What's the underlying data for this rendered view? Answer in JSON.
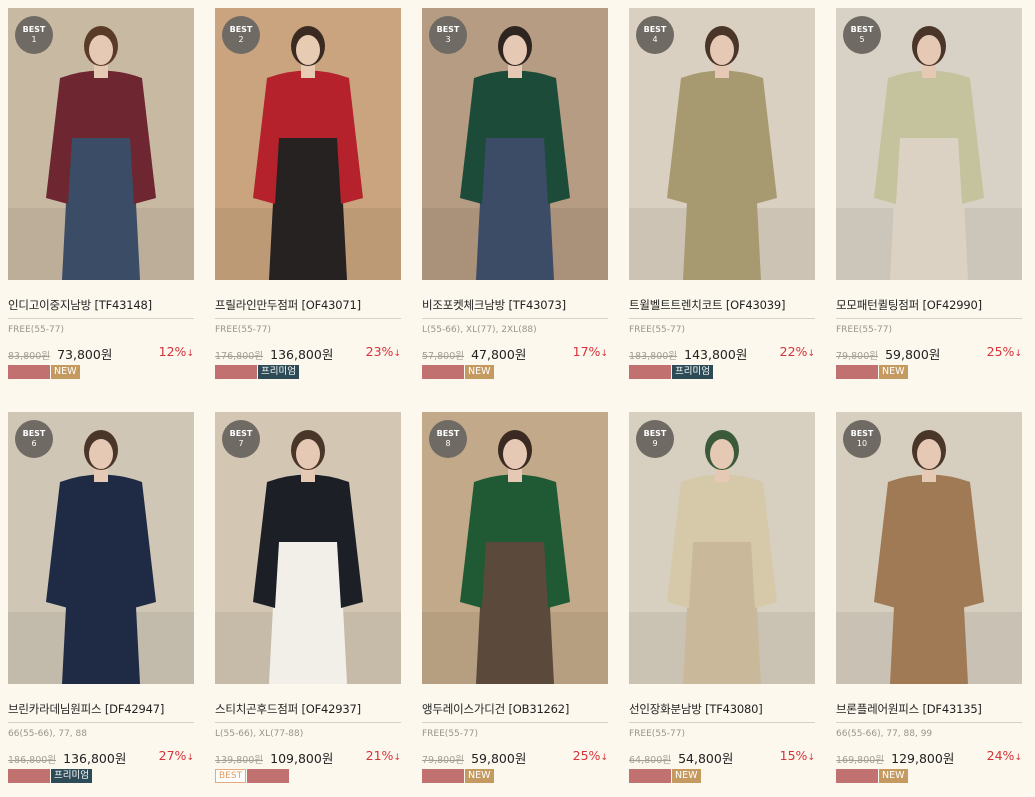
{
  "products": [
    {
      "badge_label": "BEST",
      "rank": "1",
      "title": "인디고이중지남방 [TF43148]",
      "sizes": "FREE(55-77)",
      "original_price": "83,800원",
      "sale_price": "73,800원",
      "discount": "12%",
      "discount_arrow": "↓",
      "tags": [
        {
          "type": "blank",
          "text": ""
        },
        {
          "type": "new",
          "text": "NEW"
        }
      ],
      "colors": {
        "bg": "#c8b9a2",
        "top": "#6e2630",
        "bottom": "#3a4c66",
        "skin": "#e6c9b5",
        "hair": "#5a3b28"
      }
    },
    {
      "badge_label": "BEST",
      "rank": "2",
      "title": "프릴라인만두점퍼 [OF43071]",
      "sizes": "FREE(55-77)",
      "original_price": "176,800원",
      "sale_price": "136,800원",
      "discount": "23%",
      "discount_arrow": "↓",
      "tags": [
        {
          "type": "blank",
          "text": ""
        },
        {
          "type": "premium",
          "text": "프리미엄"
        }
      ],
      "colors": {
        "bg": "#c9a47e",
        "top": "#b5222b",
        "bottom": "#262222",
        "skin": "#e8cbb3",
        "hair": "#3b2a22"
      }
    },
    {
      "badge_label": "BEST",
      "rank": "3",
      "title": "비조포켓체크남방 [TF43073]",
      "sizes": "L(55-66), XL(77), 2XL(88)",
      "original_price": "57,800원",
      "sale_price": "47,800원",
      "discount": "17%",
      "discount_arrow": "↓",
      "tags": [
        {
          "type": "blank",
          "text": ""
        },
        {
          "type": "new",
          "text": "NEW"
        }
      ],
      "colors": {
        "bg": "#b59c82",
        "top": "#1d4b39",
        "bottom": "#3c4c66",
        "skin": "#e6c9b5",
        "hair": "#2e2420"
      }
    },
    {
      "badge_label": "BEST",
      "rank": "4",
      "title": "트윌벨트트렌치코트 [OF43039]",
      "sizes": "FREE(55-77)",
      "original_price": "183,800원",
      "sale_price": "143,800원",
      "discount": "22%",
      "discount_arrow": "↓",
      "tags": [
        {
          "type": "blank",
          "text": ""
        },
        {
          "type": "premium",
          "text": "프리미엄"
        }
      ],
      "colors": {
        "bg": "#d9d0c1",
        "top": "#a89a70",
        "bottom": "#a89a70",
        "skin": "#e6c9b5",
        "hair": "#4a3628"
      }
    },
    {
      "badge_label": "BEST",
      "rank": "5",
      "title": "모모패턴퀼팅점퍼 [OF42990]",
      "sizes": "FREE(55-77)",
      "original_price": "79,800원",
      "sale_price": "59,800원",
      "discount": "25%",
      "discount_arrow": "↓",
      "tags": [
        {
          "type": "blank",
          "text": ""
        },
        {
          "type": "new",
          "text": "NEW"
        }
      ],
      "colors": {
        "bg": "#d8d2c6",
        "top": "#c4c39e",
        "bottom": "#dcd2c4",
        "skin": "#e6c9b5",
        "hair": "#4a3628"
      }
    },
    {
      "badge_label": "BEST",
      "rank": "6",
      "title": "브린카라데님원피스 [DF42947]",
      "sizes": "66(55-66), 77, 88",
      "original_price": "186,800원",
      "sale_price": "136,800원",
      "discount": "27%",
      "discount_arrow": "↓",
      "tags": [
        {
          "type": "blank",
          "text": ""
        },
        {
          "type": "premium",
          "text": "프리미엄"
        }
      ],
      "colors": {
        "bg": "#cfc6b6",
        "top": "#1f2a44",
        "bottom": "#1f2a44",
        "skin": "#e6c9b5",
        "hair": "#4a3628"
      }
    },
    {
      "badge_label": "BEST",
      "rank": "7",
      "title": "스티치곤후드점퍼 [OF42937]",
      "sizes": "L(55-66), XL(77-88)",
      "original_price": "139,800원",
      "sale_price": "109,800원",
      "discount": "21%",
      "discount_arrow": "↓",
      "tags": [
        {
          "type": "best",
          "text": "BEST"
        },
        {
          "type": "blank",
          "text": ""
        }
      ],
      "colors": {
        "bg": "#d3c7b4",
        "top": "#1c1f26",
        "bottom": "#f2efe9",
        "skin": "#e6c9b5",
        "hair": "#4a3628"
      }
    },
    {
      "badge_label": "BEST",
      "rank": "8",
      "title": "앵두레이스가디건 [OB31262]",
      "sizes": "FREE(55-77)",
      "original_price": "79,800원",
      "sale_price": "59,800원",
      "discount": "25%",
      "discount_arrow": "↓",
      "tags": [
        {
          "type": "blank",
          "text": ""
        },
        {
          "type": "new",
          "text": "NEW"
        }
      ],
      "colors": {
        "bg": "#c2a989",
        "top": "#1f5a34",
        "bottom": "#5b4a3c",
        "skin": "#e6c9b5",
        "hair": "#3b2a22"
      }
    },
    {
      "badge_label": "BEST",
      "rank": "9",
      "title": "선인장화분남방 [TF43080]",
      "sizes": "FREE(55-77)",
      "original_price": "64,800원",
      "sale_price": "54,800원",
      "discount": "15%",
      "discount_arrow": "↓",
      "tags": [
        {
          "type": "blank",
          "text": ""
        },
        {
          "type": "new",
          "text": "NEW"
        }
      ],
      "colors": {
        "bg": "#d7cfbf",
        "top": "#d6c9a9",
        "bottom": "#c9b99a",
        "skin": "#e6c9b5",
        "hair": "#3b5a3a"
      }
    },
    {
      "badge_label": "BEST",
      "rank": "10",
      "title": "브론플레어원피스 [DF43135]",
      "sizes": "66(55-66), 77, 88, 99",
      "original_price": "169,800원",
      "sale_price": "129,800원",
      "discount": "24%",
      "discount_arrow": "↓",
      "tags": [
        {
          "type": "blank",
          "text": ""
        },
        {
          "type": "new",
          "text": "NEW"
        }
      ],
      "colors": {
        "bg": "#d6cebf",
        "top": "#a07a55",
        "bottom": "#a07a55",
        "skin": "#e6c9b5",
        "hair": "#4a3628"
      }
    }
  ]
}
